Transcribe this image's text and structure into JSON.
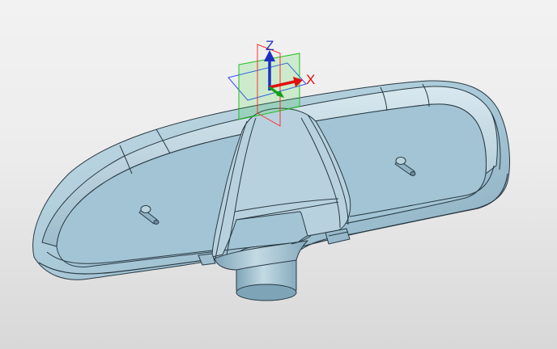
{
  "viewport": {
    "background_top": "#f2f2f2",
    "background_bottom": "#d8d8d8"
  },
  "part": {
    "body_color": "#a9c9d8",
    "edge_color": "#2a3a44"
  },
  "triad": {
    "z_label": "Z",
    "x_label": "X",
    "z_color": "#1f2fbf",
    "x_color": "#e01010",
    "y_color": "#10a010",
    "xy_plane_color": "#3050ff",
    "xz_plane_color": "#ff3030",
    "yz_plane_color": "#20c020"
  }
}
